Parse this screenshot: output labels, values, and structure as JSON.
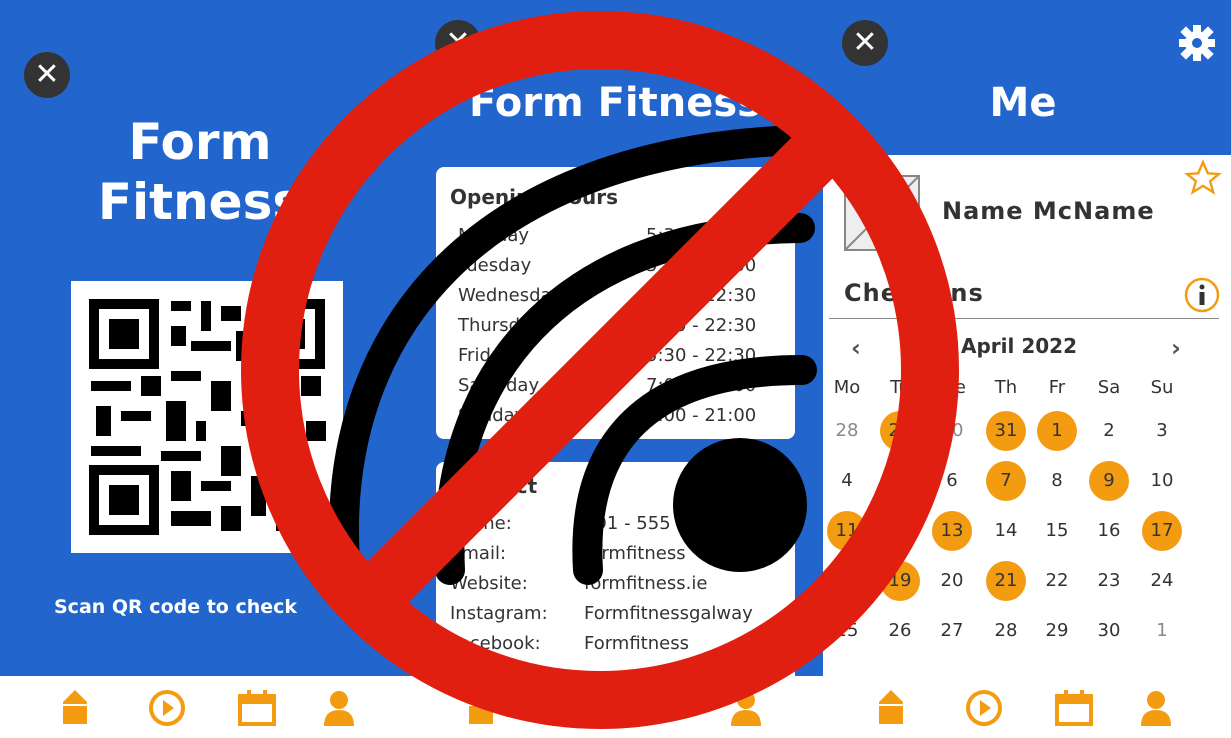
{
  "screen1": {
    "title_line1": "Form",
    "title_line2": "Fitness",
    "scan_text": "Scan QR code to check"
  },
  "screen2": {
    "title": "Form Fitness",
    "opening": {
      "title": "Opening Hours",
      "rows": [
        {
          "day": "Monday",
          "hours": "5:30 - 22:30"
        },
        {
          "day": "Tuesday",
          "hours": "5:30 - 22:30"
        },
        {
          "day": "Wednesday",
          "hours": "5:30 - 22:30"
        },
        {
          "day": "Thursday",
          "hours": "5:30 - 22:30"
        },
        {
          "day": "Friday",
          "hours": "5:30 - 22:30"
        },
        {
          "day": "Saturday",
          "hours": "7:00 - 21:00"
        },
        {
          "day": "Sunday",
          "hours": "7:00 - 21:00"
        }
      ]
    },
    "contact": {
      "title": "Contact",
      "rows": [
        {
          "label": "Phone:",
          "value": "091 - 555"
        },
        {
          "label": "Email:",
          "value": "formfitness"
        },
        {
          "label": "Website:",
          "value": "formfitness.ie"
        },
        {
          "label": "Instagram:",
          "value": "Formfitnessgalway"
        },
        {
          "label": "Facebook:",
          "value": "Formfitness"
        }
      ]
    }
  },
  "screen3": {
    "title": "Me",
    "name": "Name McName",
    "checkins_title": "Check-ins",
    "month": "April 2022",
    "weekdays": [
      "Mo",
      "Tu",
      "We",
      "Th",
      "Fr",
      "Sa",
      "Su"
    ],
    "weeks": [
      [
        {
          "d": "28",
          "m": true,
          "c": false
        },
        {
          "d": "29",
          "m": false,
          "c": true
        },
        {
          "d": "30",
          "m": true,
          "c": false
        },
        {
          "d": "31",
          "m": false,
          "c": true
        },
        {
          "d": "1",
          "m": false,
          "c": true
        },
        {
          "d": "2",
          "m": false,
          "c": false
        },
        {
          "d": "3",
          "m": false,
          "c": false
        }
      ],
      [
        {
          "d": "4",
          "m": false,
          "c": false
        },
        {
          "d": "5",
          "m": false,
          "c": false
        },
        {
          "d": "6",
          "m": false,
          "c": false
        },
        {
          "d": "7",
          "m": false,
          "c": true
        },
        {
          "d": "8",
          "m": false,
          "c": false
        },
        {
          "d": "9",
          "m": false,
          "c": true
        },
        {
          "d": "10",
          "m": false,
          "c": false
        }
      ],
      [
        {
          "d": "11",
          "m": false,
          "c": true
        },
        {
          "d": "12",
          "m": false,
          "c": false
        },
        {
          "d": "13",
          "m": false,
          "c": true
        },
        {
          "d": "14",
          "m": false,
          "c": false
        },
        {
          "d": "15",
          "m": false,
          "c": false
        },
        {
          "d": "16",
          "m": false,
          "c": false
        },
        {
          "d": "17",
          "m": false,
          "c": true
        }
      ],
      [
        {
          "d": "18",
          "m": false,
          "c": false
        },
        {
          "d": "19",
          "m": false,
          "c": true
        },
        {
          "d": "20",
          "m": false,
          "c": false
        },
        {
          "d": "21",
          "m": false,
          "c": true
        },
        {
          "d": "22",
          "m": false,
          "c": false
        },
        {
          "d": "23",
          "m": false,
          "c": false
        },
        {
          "d": "24",
          "m": false,
          "c": false
        }
      ],
      [
        {
          "d": "25",
          "m": false,
          "c": false
        },
        {
          "d": "26",
          "m": false,
          "c": false
        },
        {
          "d": "27",
          "m": false,
          "c": false
        },
        {
          "d": "28",
          "m": false,
          "c": false
        },
        {
          "d": "29",
          "m": false,
          "c": false
        },
        {
          "d": "30",
          "m": false,
          "c": false
        },
        {
          "d": "1",
          "m": true,
          "c": false
        }
      ]
    ]
  },
  "nav": {
    "icons": [
      "home-icon",
      "play-icon",
      "calendar-icon",
      "profile-icon"
    ]
  },
  "colors": {
    "brand_blue": "#2265cc",
    "accent_orange": "#f39c12",
    "overlay_red": "#e01f10"
  }
}
